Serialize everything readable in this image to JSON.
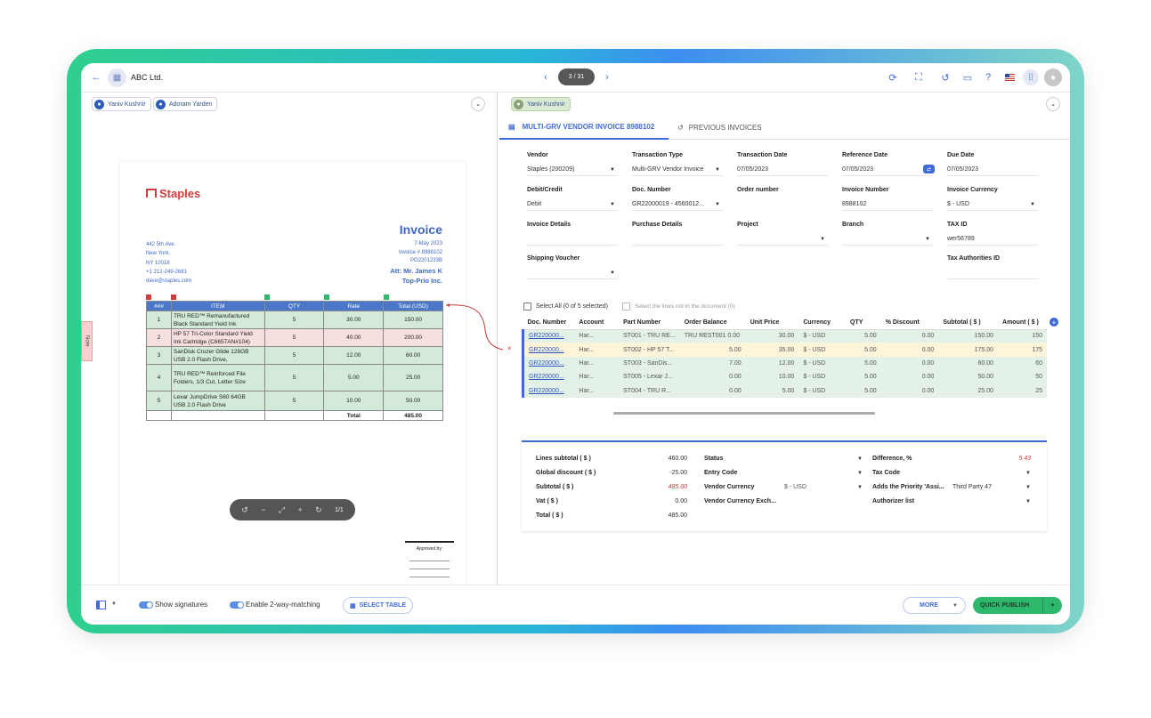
{
  "header": {
    "company": "ABC Ltd.",
    "pager": "3 / 31"
  },
  "users_left": [
    "Yaniv Kushnir",
    "Adoram Yarden"
  ],
  "user_right": "Yaniv Kushnir",
  "note_tab": "Note",
  "document": {
    "logo": "Staples",
    "title": "Invoice",
    "date": "7-May 2023",
    "invoice_no": "Invoice # 8988102",
    "po": "PO2201233B",
    "att": "Att: Mr. James K",
    "customer": "Top-Prio Inc.",
    "address": [
      "442 5th Ave.",
      "New York,",
      "NY 10018",
      "+1 212-249-2681",
      "dave@staples.com"
    ],
    "table_headers": [
      "###",
      "ITEM",
      "QTY",
      "Rate",
      "Total (USD)"
    ],
    "rows": [
      {
        "n": "1",
        "item1": "TRU RED™ Remanufactured",
        "item2": "Black Standard Yield Ink",
        "qty": "5",
        "rate": "30.00",
        "total": "150.00"
      },
      {
        "n": "2",
        "item1": "HP 57 Tri-Color Standard Yield",
        "item2": "Ink Cartridge (C6657AN#104)",
        "qty": "5",
        "rate": "40.00",
        "total": "200.00"
      },
      {
        "n": "3",
        "item1": "SanDisk Cruzer Glide 128GB",
        "item2": "USB 2.0 Flash Drive,",
        "qty": "5",
        "rate": "12.00",
        "total": "60.00"
      },
      {
        "n": "4",
        "item1": "TRU RED™ Reinforced File",
        "item2": "Folders, 1/3 Cut, Letter Size",
        "qty": "5",
        "rate": "5.00",
        "total": "25.00"
      },
      {
        "n": "5",
        "item1": "Lexar JumpDrive S60 64GB",
        "item2": "USB 2.0 Flash Drive",
        "qty": "5",
        "rate": "10.00",
        "total": "50.00"
      }
    ],
    "total_label": "Total",
    "total_value": "485.00",
    "approved": "Approved by:",
    "page_counter": "1/1"
  },
  "tabs": {
    "active": "MULTI-GRV VENDOR INVOICE 8988102",
    "other": "PREVIOUS INVOICES"
  },
  "form": {
    "vendor_l": "Vendor",
    "vendor_v": "Staples (200209)",
    "ttype_l": "Transaction Type",
    "ttype_v": "Multi-GRV Vendor Invoice",
    "tdate_l": "Transaction Date",
    "tdate_v": "07/05/2023",
    "rdate_l": "Reference Date",
    "rdate_v": "07/05/2023",
    "due_l": "Due Date",
    "due_v": "07/05/2023",
    "dc_l": "Debit/Credit",
    "dc_v": "Debit",
    "docno_l": "Doc. Number",
    "docno_v": "GR22000019 - 4560012...",
    "order_l": "Order number",
    "invno_l": "Invoice Number",
    "invno_v": "8988102",
    "cur_l": "Invoice Currency",
    "cur_v": "$ - USD",
    "invdet_l": "Invoice Details",
    "purdet_l": "Purchase Details",
    "proj_l": "Project",
    "branch_l": "Branch",
    "tax_l": "TAX ID",
    "tax_v": "wer56789",
    "ship_l": "Shipping Voucher",
    "taxauth_l": "Tax Authorities ID"
  },
  "select_all": "Select All (0 of 5 selected)",
  "select_missing": "Select the lines not in the document (0)",
  "grid": {
    "headers": [
      "Doc. Number",
      "Account",
      "Part Number",
      "Order Balance",
      "Unit Price",
      "Currency",
      "QTY",
      "% Discount",
      "Subtotal ( $ )",
      "Amount ( $ )"
    ],
    "rows": [
      {
        "doc": "GR220000...",
        "acc": "Har...",
        "part": "ST001 - TRU RE...",
        "bal": "TRU REST001 0.00",
        "price": "30.00",
        "cur": "$ - USD",
        "qty": "5.00",
        "disc": "0.00",
        "sub": "150.00",
        "amt": "150"
      },
      {
        "doc": "GR220000...",
        "acc": "Har...",
        "part": "ST002 - HP 57 T...",
        "bal": "5.00",
        "price": "35.00",
        "cur": "$ - USD",
        "qty": "5.00",
        "disc": "0.00",
        "sub": "175.00",
        "amt": "175"
      },
      {
        "doc": "GR220000...",
        "acc": "Har...",
        "part": "ST003 - SanDis...",
        "bal": "7.00",
        "price": "12.00",
        "cur": "$ - USD",
        "qty": "5.00",
        "disc": "0.00",
        "sub": "60.00",
        "amt": "60"
      },
      {
        "doc": "GR220000...",
        "acc": "Har...",
        "part": "ST005 - Lexar J...",
        "bal": "0.00",
        "price": "10.00",
        "cur": "$ - USD",
        "qty": "5.00",
        "disc": "0.00",
        "sub": "50.00",
        "amt": "50"
      },
      {
        "doc": "GR220000...",
        "acc": "Har...",
        "part": "ST004 - TRU R...",
        "bal": "0.00",
        "price": "5.00",
        "cur": "$ - USD",
        "qty": "5.00",
        "disc": "0.00",
        "sub": "25.00",
        "amt": "25"
      }
    ]
  },
  "summary": {
    "lines_l": "Lines subtotal ( $ )",
    "lines_v": "460.00",
    "gdisc_l": "Global discount ( $ )",
    "gdisc_v": "-25.00",
    "sub_l": "Subtotal ( $ )",
    "sub_v": "485.00",
    "vat_l": "Vat ( $ )",
    "vat_v": "0.00",
    "total_l": "Total ( $ )",
    "total_v": "485.00",
    "status_l": "Status",
    "entry_l": "Entry Code",
    "vcur_l": "Vendor Currency",
    "vcur_v": "$ - USD",
    "vcurx_l": "Vendor Currency Exch...",
    "diff_l": "Difference, %",
    "diff_v": "5.43",
    "taxc_l": "Tax Code",
    "prio_l": "Adds the Priority 'Assi...",
    "prio_v": "Third Party 47",
    "auth_l": "Authorizer list"
  },
  "footer": {
    "show_sig": "Show signatures",
    "two_way": "Enable 2-way-matching",
    "select_table": "SELECT TABLE",
    "more": "MORE",
    "publish": "QUICK PUBLISH"
  },
  "colors": {
    "accent": "#3f6ad8",
    "green": "#2eb86b",
    "red": "#d9343a"
  }
}
